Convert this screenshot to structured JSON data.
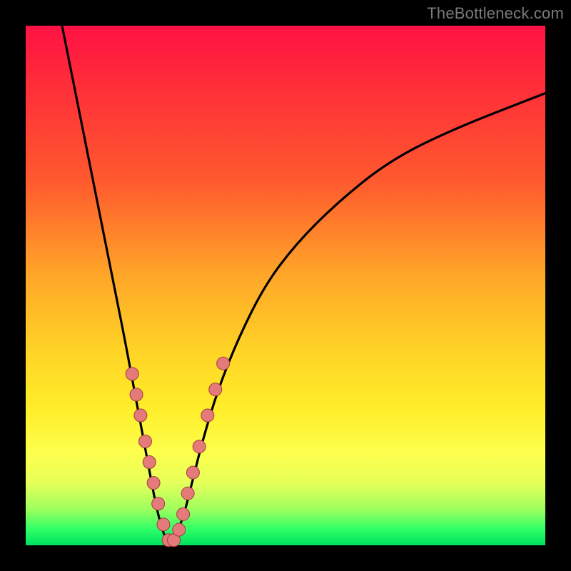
{
  "watermark": "TheBottleneck.com",
  "colors": {
    "frame_bg": "#000000",
    "gradient_top": "#ff1244",
    "gradient_mid1": "#ff5a2e",
    "gradient_mid2": "#ffd226",
    "gradient_mid3": "#fdff4c",
    "gradient_bottom": "#00e060",
    "curve_stroke": "#000000",
    "marker_fill": "#e47a7a",
    "marker_stroke": "#a03e3e"
  },
  "chart_data": {
    "type": "line",
    "title": "",
    "xlabel": "",
    "ylabel": "",
    "xlim": [
      0,
      100
    ],
    "ylim": [
      0,
      100
    ],
    "series": [
      {
        "name": "left-branch",
        "x": [
          7,
          9,
          11,
          13,
          15,
          17,
          19,
          20.5,
          22,
          23.5,
          25,
          26,
          27,
          28
        ],
        "y": [
          100,
          90,
          80,
          70,
          60,
          50,
          40,
          32,
          24,
          16,
          8,
          4,
          1,
          0
        ]
      },
      {
        "name": "right-branch",
        "x": [
          28,
          29,
          30.5,
          32,
          34,
          37,
          41,
          46,
          52,
          60,
          70,
          82,
          100
        ],
        "y": [
          0,
          2,
          6,
          12,
          20,
          30,
          40,
          50,
          58,
          66,
          74,
          80,
          87
        ]
      }
    ],
    "markers": {
      "name": "highlighted-points",
      "x": [
        20.5,
        21.3,
        22.1,
        23,
        23.8,
        24.6,
        25.5,
        26.5,
        27.5,
        28.5,
        29.5,
        30.3,
        31.2,
        32.2,
        33.4,
        35,
        36.5,
        38
      ],
      "y": [
        33,
        29,
        25,
        20,
        16,
        12,
        8,
        4,
        1,
        1,
        3,
        6,
        10,
        14,
        19,
        25,
        30,
        35
      ]
    }
  }
}
